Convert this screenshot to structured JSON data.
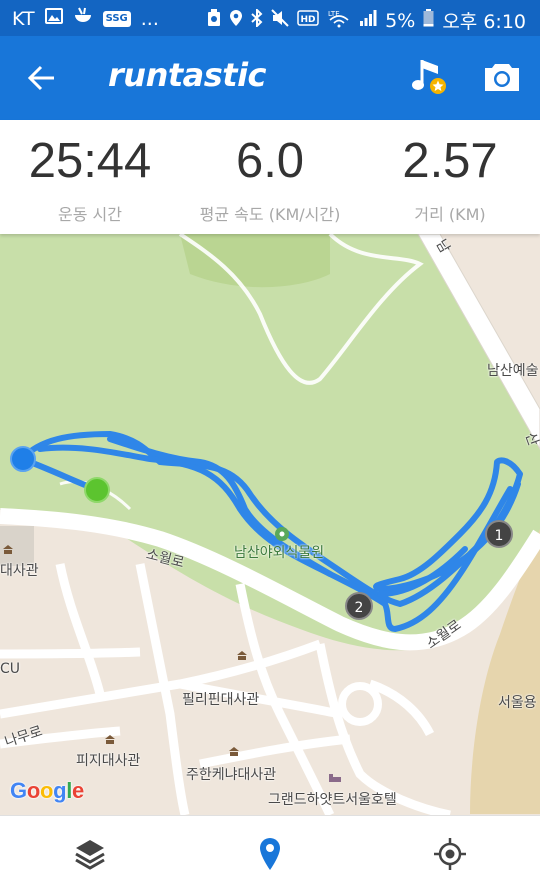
{
  "status_bar": {
    "carrier": "KT",
    "ssg": "SSG",
    "more": "...",
    "battery": "5%",
    "time": "오후 6:10"
  },
  "app_bar": {
    "logo": "runtastic",
    "colors": {
      "header": "#1876d9",
      "status_bar": "#1365c2"
    }
  },
  "stats": [
    {
      "value": "25:44",
      "label": "운동 시간"
    },
    {
      "value": "6.0",
      "label": "평균 속도 (KM/시간)"
    },
    {
      "value": "2.57",
      "label": "거리 (KM)"
    }
  ],
  "map": {
    "labels": {
      "namsan_arts": "남산예술",
      "botanical_garden": "남산야외식물원",
      "sowol_ro_1": "소월로",
      "sowol_ro_2": "소월로",
      "embassy_left": "대사관",
      "cu": "CU",
      "namu_ro": "나무로",
      "philippines_embassy": "필리핀대사관",
      "fiji_embassy": "피지대사관",
      "kenya_embassy": "주한케냐대사관",
      "grand_hyatt": "그랜드하얏트서울호텔",
      "seoul_right": "서울용",
      "right_edge": "산",
      "top_edge": "남"
    },
    "km_markers": [
      "1",
      "2"
    ],
    "google": [
      "G",
      "o",
      "o",
      "g",
      "l",
      "e"
    ],
    "colors": {
      "route": "#2f86e8",
      "start": "#1f7fe8",
      "finish": "#5cc42f",
      "park": "#c8dfa9"
    }
  },
  "bottom_bar": {
    "icons": [
      "layers-icon",
      "location-pin-icon",
      "gps-target-icon"
    ]
  }
}
